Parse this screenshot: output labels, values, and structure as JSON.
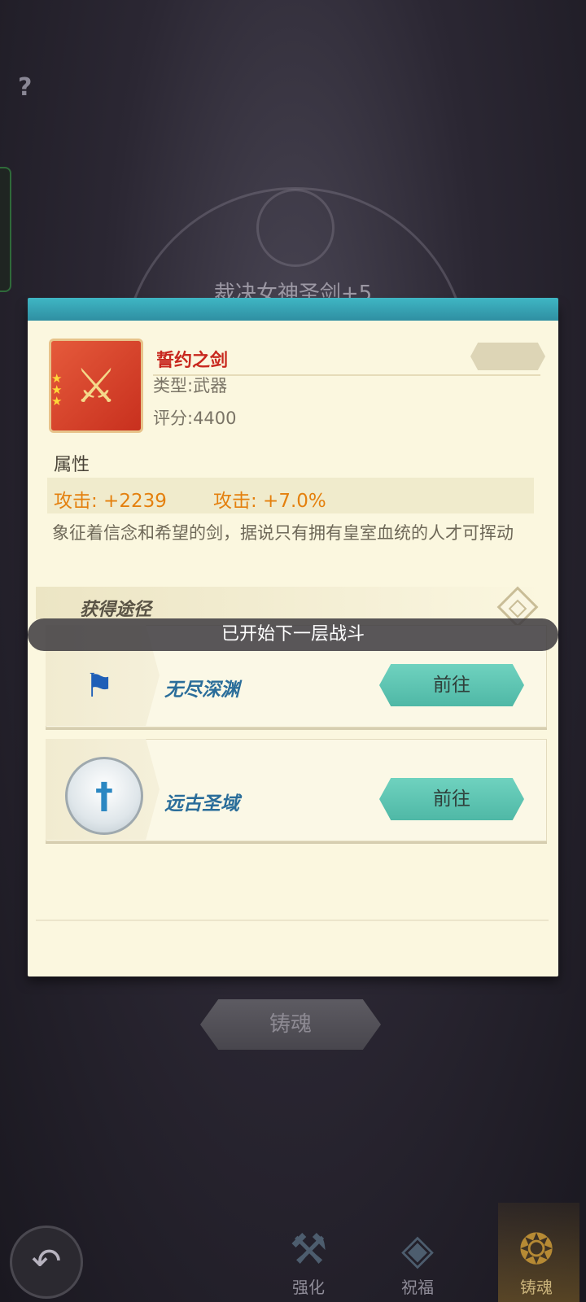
{
  "background": {
    "help_label": "?",
    "behind_title": "裁决女神圣剑+5"
  },
  "item": {
    "name": "誓约之剑",
    "type_text": "类型:武器",
    "score_text": "评分:4400",
    "stars": "★★★"
  },
  "attributes": {
    "section_label": "属性",
    "attr1": "攻击: +2239",
    "attr2": "攻击: +7.0%"
  },
  "description": "象征着信念和希望的剑，据说只有拥有皇室血统的人才可挥动",
  "sources": {
    "title": "获得途径",
    "items": [
      {
        "name": "无尽深渊",
        "button": "前往",
        "icon": "flag-icon"
      },
      {
        "name": "远古圣域",
        "button": "前往",
        "icon": "shrine-icon"
      }
    ]
  },
  "toast": "已开始下一层战斗",
  "cast_button": "铸魂",
  "nav": {
    "back_icon": "back-arrow-icon",
    "tabs": [
      {
        "label": "强化",
        "icon": "anvil-icon"
      },
      {
        "label": "祝福",
        "icon": "blessing-icon"
      },
      {
        "label": "铸魂",
        "icon": "soul-forge-icon",
        "active": true
      }
    ]
  },
  "colors": {
    "accent_teal": "#4fb8a6",
    "item_name_red": "#c8281e",
    "attr_orange": "#e4800e"
  }
}
